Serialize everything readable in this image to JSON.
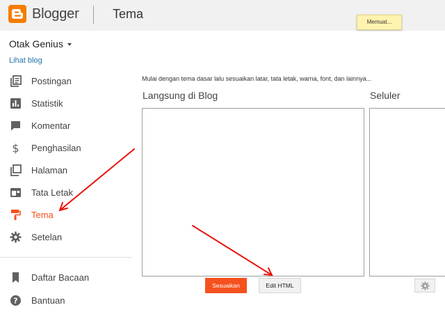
{
  "header": {
    "brand": "Blogger",
    "page_title": "Tema",
    "loading_text": "Memuat..."
  },
  "sidebar": {
    "blog_name": "Otak Genius",
    "view_blog": "Lihat blog",
    "items": [
      {
        "label": "Postingan",
        "icon": "posts-icon"
      },
      {
        "label": "Statistik",
        "icon": "stats-icon"
      },
      {
        "label": "Komentar",
        "icon": "comment-icon"
      },
      {
        "label": "Penghasilan",
        "icon": "dollar-icon"
      },
      {
        "label": "Halaman",
        "icon": "pages-icon"
      },
      {
        "label": "Tata Letak",
        "icon": "layout-icon"
      },
      {
        "label": "Tema",
        "icon": "paint-roller-icon",
        "active": true
      },
      {
        "label": "Setelan",
        "icon": "gear-icon"
      },
      {
        "label": "Daftar Bacaan",
        "icon": "bookmark-icon"
      },
      {
        "label": "Bantuan",
        "icon": "help-icon"
      }
    ]
  },
  "main": {
    "intro": "Mulai dengan tema dasar lalu sesuaikan latar, tata letak, warna, font, dan lainnya...",
    "live_title": "Langsung di Blog",
    "mobile_title": "Seluler",
    "customize_label": "Sesuaikan",
    "edit_html_label": "Edit HTML"
  },
  "colors": {
    "accent": "#f4511e",
    "logo": "#f57d00",
    "link": "#1a73a8",
    "annotation_arrow": "#e8140c"
  }
}
